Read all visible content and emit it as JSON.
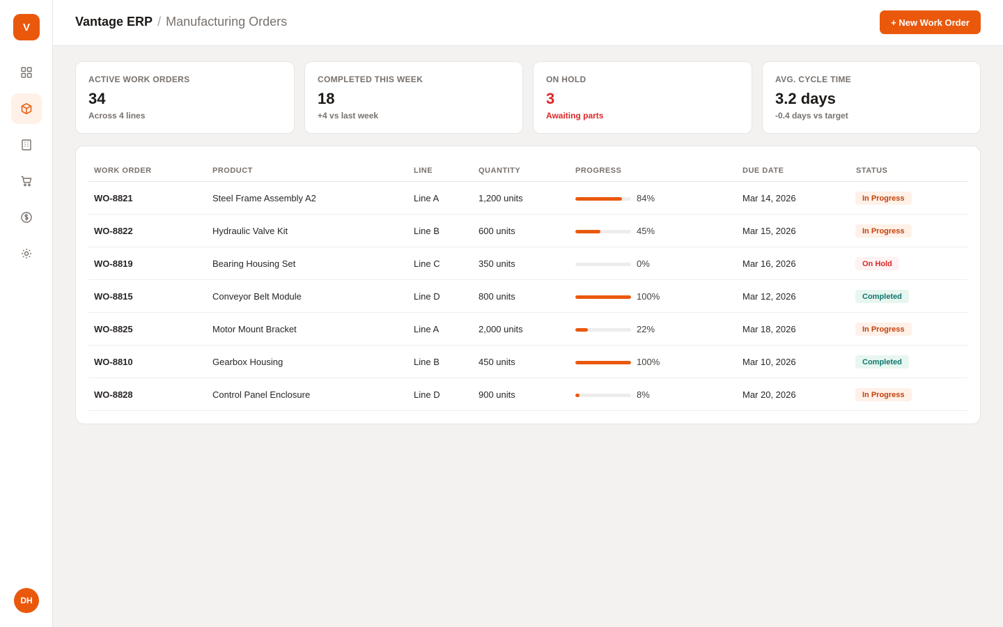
{
  "app": {
    "logo_letter": "V",
    "name": "Vantage ERP",
    "separator": "/",
    "page": "Manufacturing Orders"
  },
  "sidebar": {
    "items": [
      {
        "icon": "dashboard-icon",
        "active": false
      },
      {
        "icon": "box-icon",
        "active": true
      },
      {
        "icon": "building-icon",
        "active": false
      },
      {
        "icon": "cart-icon",
        "active": false
      },
      {
        "icon": "dollar-icon",
        "active": false
      },
      {
        "icon": "settings-icon",
        "active": false
      }
    ],
    "avatar": "DH"
  },
  "toolbar": {
    "new_label": "+ New Work Order"
  },
  "stats": [
    {
      "label": "ACTIVE WORK ORDERS",
      "value": "34",
      "sub": "Across 4 lines",
      "alert": false
    },
    {
      "label": "COMPLETED THIS WEEK",
      "value": "18",
      "sub": "+4 vs last week",
      "alert": false
    },
    {
      "label": "ON HOLD",
      "value": "3",
      "sub": "Awaiting parts",
      "alert": true
    },
    {
      "label": "AVG. CYCLE TIME",
      "value": "3.2 days",
      "sub": "-0.4 days vs target",
      "alert": false
    }
  ],
  "table": {
    "columns": [
      "WORK ORDER",
      "PRODUCT",
      "LINE",
      "QUANTITY",
      "PROGRESS",
      "DUE DATE",
      "STATUS"
    ],
    "rows": [
      {
        "id": "WO-8821",
        "product": "Steel Frame Assembly A2",
        "line": "Line A",
        "qty": "1,200 units",
        "progress": 84,
        "progress_label": "84%",
        "due": "Mar 14, 2026",
        "status": "In Progress",
        "status_kind": "progress"
      },
      {
        "id": "WO-8822",
        "product": "Hydraulic Valve Kit",
        "line": "Line B",
        "qty": "600 units",
        "progress": 45,
        "progress_label": "45%",
        "due": "Mar 15, 2026",
        "status": "In Progress",
        "status_kind": "progress"
      },
      {
        "id": "WO-8819",
        "product": "Bearing Housing Set",
        "line": "Line C",
        "qty": "350 units",
        "progress": 0,
        "progress_label": "0%",
        "due": "Mar 16, 2026",
        "status": "On Hold",
        "status_kind": "hold"
      },
      {
        "id": "WO-8815",
        "product": "Conveyor Belt Module",
        "line": "Line D",
        "qty": "800 units",
        "progress": 100,
        "progress_label": "100%",
        "due": "Mar 12, 2026",
        "status": "Completed",
        "status_kind": "done"
      },
      {
        "id": "WO-8825",
        "product": "Motor Mount Bracket",
        "line": "Line A",
        "qty": "2,000 units",
        "progress": 22,
        "progress_label": "22%",
        "due": "Mar 18, 2026",
        "status": "In Progress",
        "status_kind": "progress"
      },
      {
        "id": "WO-8810",
        "product": "Gearbox Housing",
        "line": "Line B",
        "qty": "450 units",
        "progress": 100,
        "progress_label": "100%",
        "due": "Mar 10, 2026",
        "status": "Completed",
        "status_kind": "done"
      },
      {
        "id": "WO-8828",
        "product": "Control Panel Enclosure",
        "line": "Line D",
        "qty": "900 units",
        "progress": 8,
        "progress_label": "8%",
        "due": "Mar 20, 2026",
        "status": "In Progress",
        "status_kind": "progress"
      }
    ]
  }
}
